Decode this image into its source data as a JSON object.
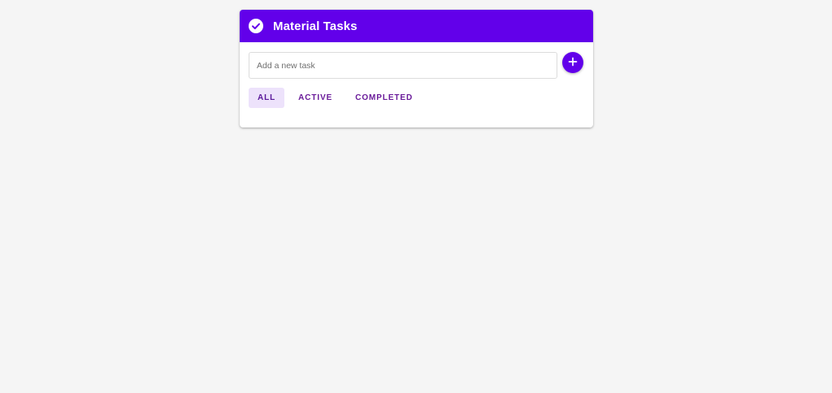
{
  "header": {
    "title": "Material Tasks",
    "icon": "check-circle-icon",
    "background": "#6200ea"
  },
  "input": {
    "placeholder": "Add a new task",
    "value": ""
  },
  "add_button": {
    "icon": "plus-icon",
    "label": "+"
  },
  "filters": {
    "tabs": [
      {
        "label": "ALL",
        "selected": true
      },
      {
        "label": "ACTIVE",
        "selected": false
      },
      {
        "label": "COMPLETED",
        "selected": false
      }
    ]
  },
  "colors": {
    "accent": "#6200ea",
    "page_background": "#f5f5f5",
    "tab_text": "#6a1b9a",
    "active_tab_background": "#ede2fb"
  }
}
